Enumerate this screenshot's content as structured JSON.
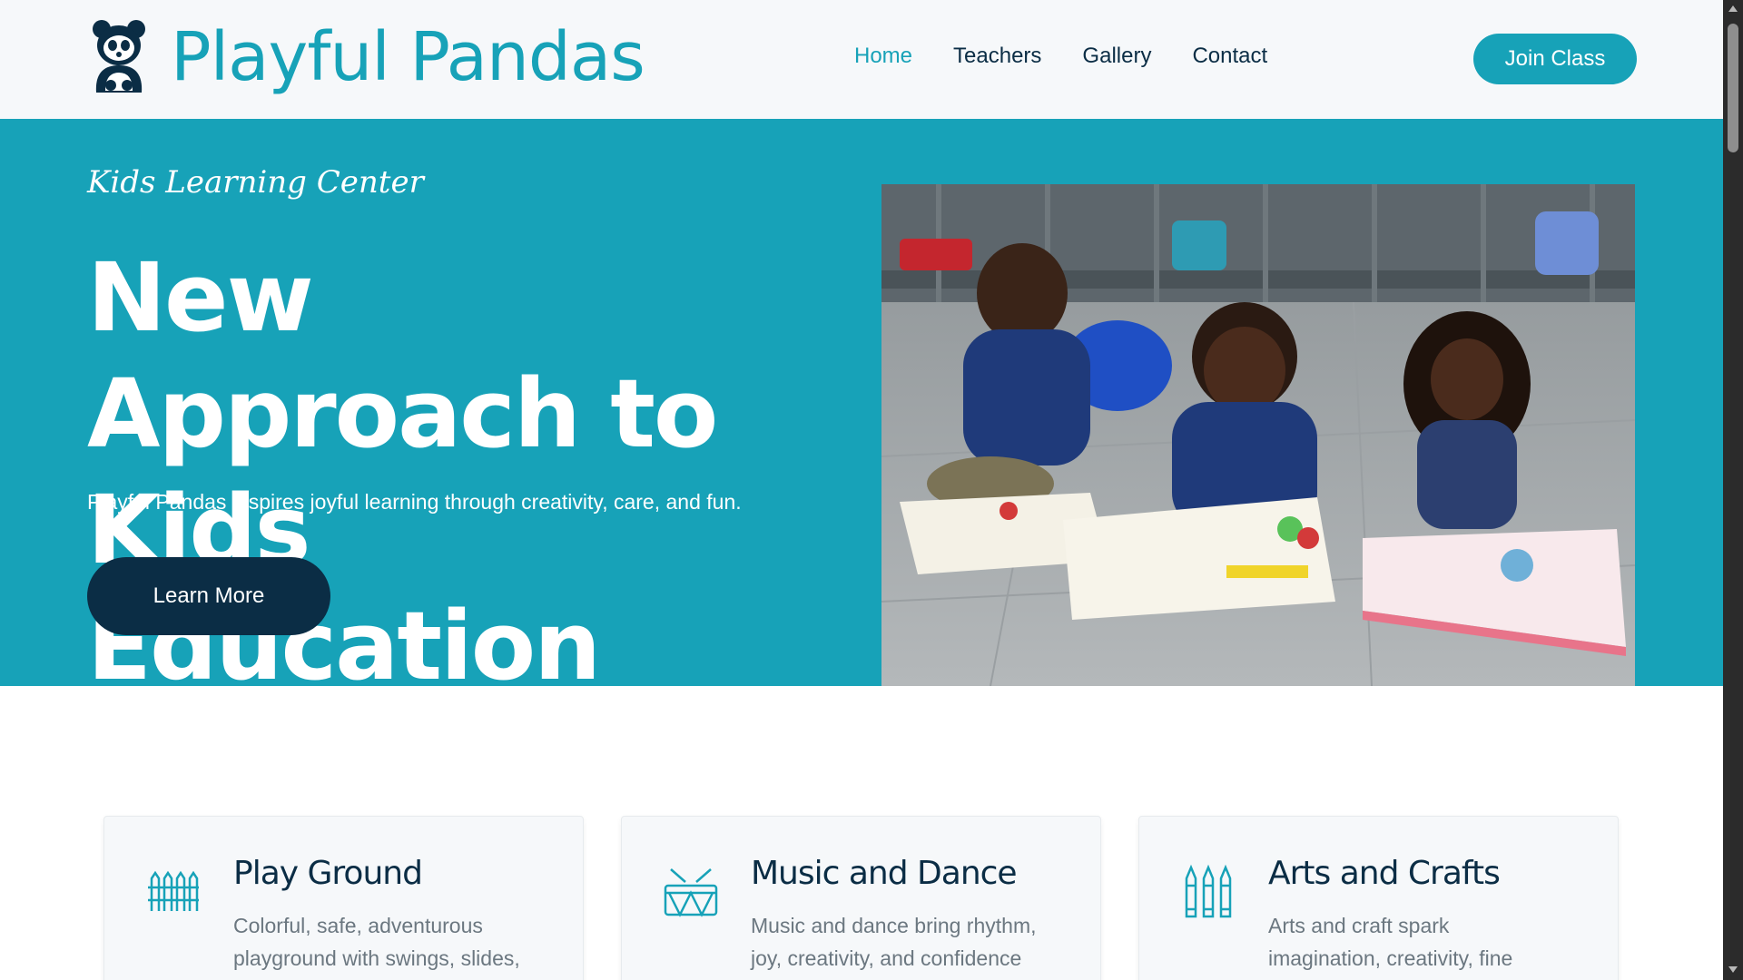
{
  "brand": {
    "name": "Playful Pandas",
    "icon": "panda-icon"
  },
  "nav": {
    "items": [
      {
        "label": "Home",
        "active": true
      },
      {
        "label": "Teachers",
        "active": false
      },
      {
        "label": "Gallery",
        "active": false
      },
      {
        "label": "Contact",
        "active": false
      }
    ],
    "cta_label": "Join Class"
  },
  "hero": {
    "subtitle": "Kids Learning Center",
    "title_line1": "New Approach to",
    "title_line2": "Kids Education",
    "description": "Playful Pandas inspires joyful learning through creativity, care, and fun.",
    "button_label": "Learn More",
    "image": "children-drawing-photo"
  },
  "features": [
    {
      "title": "Play Ground",
      "text_line1": "Colorful, safe, adventurous",
      "text_line2": "playground with swings, slides,",
      "icon": "fence-icon"
    },
    {
      "title": "Music and Dance",
      "text_line1": "Music and dance bring rhythm,",
      "text_line2": "joy, creativity, and confidence",
      "icon": "drum-icon"
    },
    {
      "title": "Arts and Crafts",
      "text_line1": "Arts and craft spark",
      "text_line2": "imagination, creativity, fine",
      "icon": "crayons-icon"
    }
  ],
  "colors": {
    "accent": "#17a2b8",
    "dark": "#0b2d45",
    "muted_text": "#6b7780",
    "header_bg": "#f6f8fa"
  }
}
